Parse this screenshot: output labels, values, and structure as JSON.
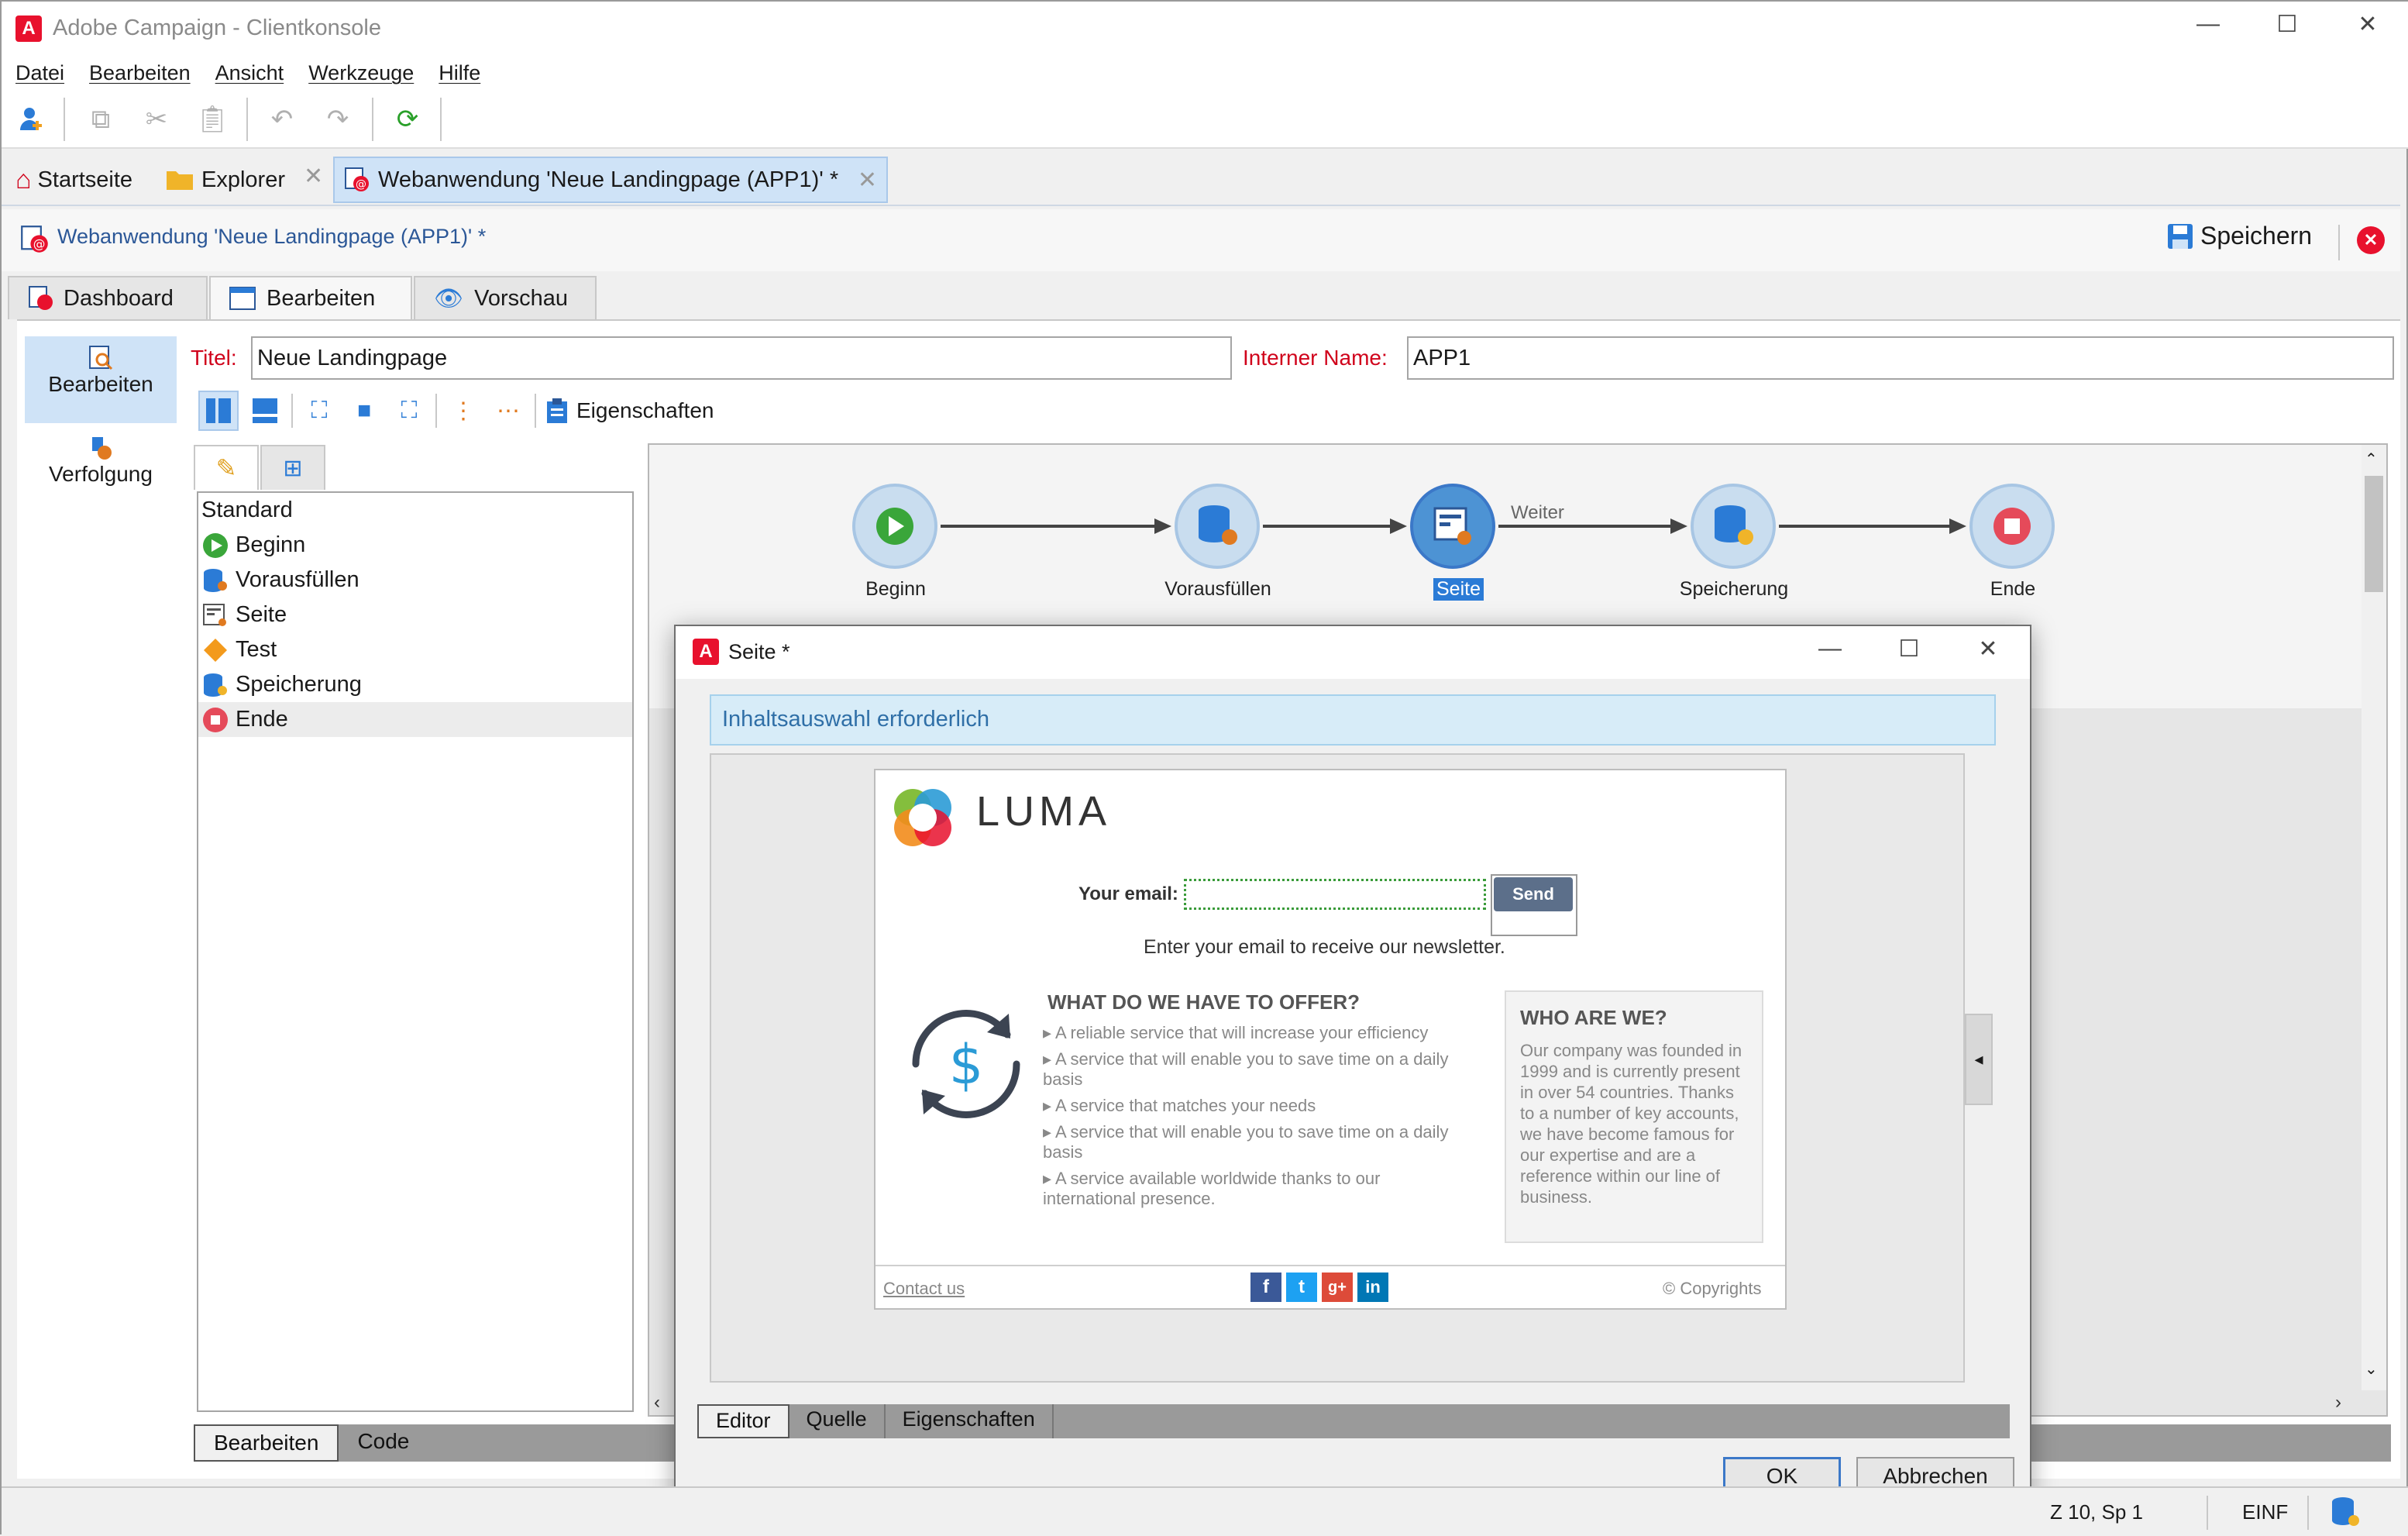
{
  "window": {
    "title": "Adobe Campaign - Clientkonsole",
    "logo_letter": "A"
  },
  "menu": [
    "Datei",
    "Bearbeiten",
    "Ansicht",
    "Werkzeuge",
    "Hilfe"
  ],
  "tabs": {
    "home": "Startseite",
    "explorer": "Explorer",
    "active": "Webanwendung 'Neue Landingpage (APP1)' *"
  },
  "document": {
    "title": "Webanwendung 'Neue Landingpage (APP1)' *",
    "save_label": "Speichern"
  },
  "subtabs": [
    "Dashboard",
    "Bearbeiten",
    "Vorschau"
  ],
  "leftnav": {
    "edit": "Bearbeiten",
    "tracking": "Verfolgung"
  },
  "form": {
    "title_label": "Titel:",
    "title_value": "Neue Landingpage",
    "internal_label": "Interner Name:",
    "internal_value": "APP1"
  },
  "editor_toolbar": {
    "properties": "Eigenschaften"
  },
  "tree": {
    "header": "Standard",
    "items": [
      {
        "label": "Beginn",
        "icon": "play-icon"
      },
      {
        "label": "Vorausfüllen",
        "icon": "database-user-icon"
      },
      {
        "label": "Seite",
        "icon": "page-icon"
      },
      {
        "label": "Test",
        "icon": "diamond-icon"
      },
      {
        "label": "Speicherung",
        "icon": "database-sync-icon"
      },
      {
        "label": "Ende",
        "icon": "stop-icon"
      }
    ]
  },
  "bottom_tabs": [
    "Bearbeiten",
    "Code"
  ],
  "workflow": {
    "nodes": [
      "Beginn",
      "Vorausfüllen",
      "Seite",
      "Speicherung",
      "Ende"
    ],
    "transition_label": "Weiter"
  },
  "dialog": {
    "title": "Seite *",
    "info": "Inhaltsauswahl erforderlich",
    "tabs": [
      "Editor",
      "Quelle",
      "Eigenschaften"
    ],
    "ok": "OK",
    "cancel": "Abbrechen"
  },
  "webpage": {
    "brand": "LUMA",
    "email_label": "Your email:",
    "send": "Send",
    "newsletter_hint": "Enter your email to receive our newsletter.",
    "offer_title": "WHAT DO WE HAVE TO OFFER?",
    "offer_items": [
      "A reliable service that will increase your efficiency",
      "A service that will enable you to save time on a daily basis",
      "A service that matches your needs",
      "A service that will enable you to save time on a daily basis",
      "A service available worldwide thanks to our international presence."
    ],
    "who_title": "WHO ARE WE?",
    "who_text": "Our company was founded in 1999 and is currently present in over 54 countries. Thanks to a number of key accounts, we have become famous for our expertise and are a reference within our line of business.",
    "contact": "Contact us",
    "copyright": "© Copyrights",
    "currency_symbol": "$"
  },
  "statusbar": {
    "position": "Z 10, Sp 1",
    "mode": "EINF"
  },
  "colors": {
    "accent": "#2b7bd6",
    "brand_red": "#e8112d",
    "info_bg": "#d7ecf8"
  }
}
